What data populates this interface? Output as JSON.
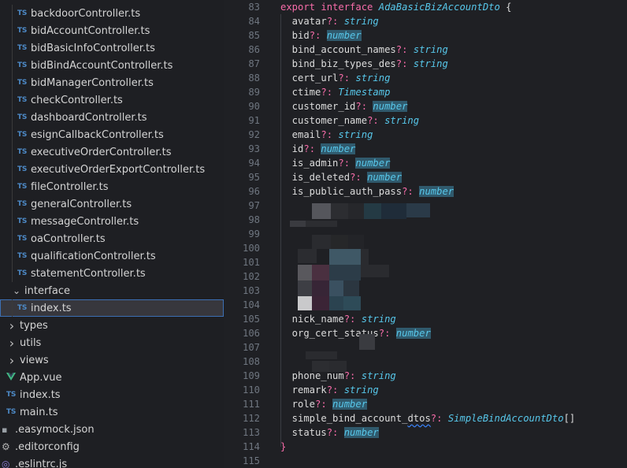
{
  "sidebar": {
    "items": [
      {
        "icon": "ts",
        "label": "backdoorController.ts",
        "indent": 1
      },
      {
        "icon": "ts",
        "label": "bidAccountController.ts",
        "indent": 1
      },
      {
        "icon": "ts",
        "label": "bidBasicInfoController.ts",
        "indent": 1
      },
      {
        "icon": "ts",
        "label": "bidBindAccountController.ts",
        "indent": 1
      },
      {
        "icon": "ts",
        "label": "bidManagerController.ts",
        "indent": 1
      },
      {
        "icon": "ts",
        "label": "checkController.ts",
        "indent": 1
      },
      {
        "icon": "ts",
        "label": "dashboardController.ts",
        "indent": 1
      },
      {
        "icon": "ts",
        "label": "esignCallbackController.ts",
        "indent": 1
      },
      {
        "icon": "ts",
        "label": "executiveOrderController.ts",
        "indent": 1
      },
      {
        "icon": "ts",
        "label": "executiveOrderExportController.ts",
        "indent": 1
      },
      {
        "icon": "ts",
        "label": "fileController.ts",
        "indent": 1
      },
      {
        "icon": "ts",
        "label": "generalController.ts",
        "indent": 1
      },
      {
        "icon": "ts",
        "label": "messageController.ts",
        "indent": 1
      },
      {
        "icon": "ts",
        "label": "oaController.ts",
        "indent": 1
      },
      {
        "icon": "ts",
        "label": "qualificationController.ts",
        "indent": 1
      },
      {
        "icon": "ts",
        "label": "statementController.ts",
        "indent": 1
      },
      {
        "icon": "chevron-down",
        "label": "interface",
        "indent": 0.5
      },
      {
        "icon": "ts",
        "label": "index.ts",
        "indent": 1,
        "selected": true
      },
      {
        "icon": "chevron-right",
        "label": "types",
        "indent": 0
      },
      {
        "icon": "chevron-right",
        "label": "utils",
        "indent": 0
      },
      {
        "icon": "chevron-right",
        "label": "views",
        "indent": 0
      },
      {
        "icon": "vue",
        "label": "App.vue",
        "indent": 0
      },
      {
        "icon": "ts",
        "label": "index.ts",
        "indent": 0
      },
      {
        "icon": "ts",
        "label": "main.ts",
        "indent": 0
      },
      {
        "icon": "json",
        "label": ".easymock.json",
        "indent": -0.5
      },
      {
        "icon": "gear",
        "label": ".editorconfig",
        "indent": -0.5
      },
      {
        "icon": "eslint",
        "label": ".eslintrc.js",
        "indent": -0.5
      }
    ]
  },
  "editor": {
    "lines": [
      {
        "n": "83",
        "parts": [
          [
            "kw",
            "export interface "
          ],
          [
            "ty",
            "AdaBasicBizAccountDto"
          ],
          [
            "punc",
            " {"
          ]
        ]
      },
      {
        "n": "84",
        "parts": [
          [
            "punc",
            "  avatar"
          ],
          [
            "q",
            "?: "
          ],
          [
            "ty",
            "string"
          ]
        ]
      },
      {
        "n": "85",
        "parts": [
          [
            "punc",
            "  bid"
          ],
          [
            "q",
            "?: "
          ],
          [
            "tyhl",
            "number"
          ]
        ]
      },
      {
        "n": "86",
        "parts": [
          [
            "punc",
            "  bind_account_names"
          ],
          [
            "q",
            "?: "
          ],
          [
            "ty",
            "string"
          ]
        ]
      },
      {
        "n": "87",
        "parts": [
          [
            "punc",
            "  bind_biz_types_des"
          ],
          [
            "q",
            "?: "
          ],
          [
            "ty",
            "string"
          ]
        ]
      },
      {
        "n": "88",
        "parts": [
          [
            "punc",
            "  cert_url"
          ],
          [
            "q",
            "?: "
          ],
          [
            "ty",
            "string"
          ]
        ]
      },
      {
        "n": "89",
        "parts": [
          [
            "punc",
            "  ctime"
          ],
          [
            "q",
            "?: "
          ],
          [
            "ty",
            "Timestamp"
          ]
        ]
      },
      {
        "n": "90",
        "parts": [
          [
            "punc",
            "  customer_id"
          ],
          [
            "q",
            "?: "
          ],
          [
            "tyhl",
            "number"
          ]
        ]
      },
      {
        "n": "91",
        "parts": [
          [
            "punc",
            "  customer_name"
          ],
          [
            "q",
            "?: "
          ],
          [
            "ty",
            "string"
          ]
        ]
      },
      {
        "n": "92",
        "parts": [
          [
            "punc",
            "  email"
          ],
          [
            "q",
            "?: "
          ],
          [
            "ty",
            "string"
          ]
        ]
      },
      {
        "n": "93",
        "parts": [
          [
            "punc",
            "  id"
          ],
          [
            "q",
            "?: "
          ],
          [
            "tyhl",
            "number"
          ]
        ]
      },
      {
        "n": "94",
        "parts": [
          [
            "punc",
            "  is_admin"
          ],
          [
            "q",
            "?: "
          ],
          [
            "tyhl",
            "number"
          ]
        ]
      },
      {
        "n": "95",
        "parts": [
          [
            "punc",
            "  is_deleted"
          ],
          [
            "q",
            "?: "
          ],
          [
            "tyhl",
            "number"
          ]
        ]
      },
      {
        "n": "96",
        "parts": [
          [
            "punc",
            "  is_public_auth_pass"
          ],
          [
            "q",
            "?: "
          ],
          [
            "tyhl",
            "number"
          ]
        ]
      },
      {
        "n": "97",
        "parts": []
      },
      {
        "n": "98",
        "parts": []
      },
      {
        "n": "99",
        "parts": []
      },
      {
        "n": "100",
        "parts": []
      },
      {
        "n": "101",
        "parts": []
      },
      {
        "n": "102",
        "parts": []
      },
      {
        "n": "103",
        "parts": []
      },
      {
        "n": "104",
        "parts": []
      },
      {
        "n": "105",
        "parts": [
          [
            "punc",
            "  nick_name"
          ],
          [
            "q",
            "?: "
          ],
          [
            "ty",
            "string"
          ]
        ]
      },
      {
        "n": "106",
        "parts": [
          [
            "punc",
            "  org_cert_status"
          ],
          [
            "q",
            "?: "
          ],
          [
            "tyhl",
            "number"
          ]
        ]
      },
      {
        "n": "107",
        "parts": []
      },
      {
        "n": "108",
        "parts": []
      },
      {
        "n": "109",
        "parts": [
          [
            "punc",
            "  phone_num"
          ],
          [
            "q",
            "?: "
          ],
          [
            "ty",
            "string"
          ]
        ]
      },
      {
        "n": "110",
        "parts": [
          [
            "punc",
            "  remark"
          ],
          [
            "q",
            "?: "
          ],
          [
            "ty",
            "string"
          ]
        ]
      },
      {
        "n": "111",
        "parts": [
          [
            "punc",
            "  role"
          ],
          [
            "q",
            "?: "
          ],
          [
            "tyhl",
            "number"
          ]
        ]
      },
      {
        "n": "112",
        "parts": [
          [
            "punc",
            "  simple_bind_account_dtos"
          ],
          [
            "q",
            "?: "
          ],
          [
            "ty",
            "SimpleBindAccountDto"
          ],
          [
            "punc",
            "[]"
          ]
        ]
      },
      {
        "n": "113",
        "parts": [
          [
            "punc",
            "  status"
          ],
          [
            "q",
            "?: "
          ],
          [
            "tyhl",
            "number"
          ]
        ]
      },
      {
        "n": "114",
        "parts": [
          [
            "kw",
            "}"
          ]
        ]
      },
      {
        "n": "115",
        "parts": []
      }
    ]
  },
  "colors": {
    "background": "#1f2024",
    "keyword": "#f76ca9",
    "type": "#57c7ea",
    "line_number": "#6f7680",
    "selection": "#37373d"
  }
}
